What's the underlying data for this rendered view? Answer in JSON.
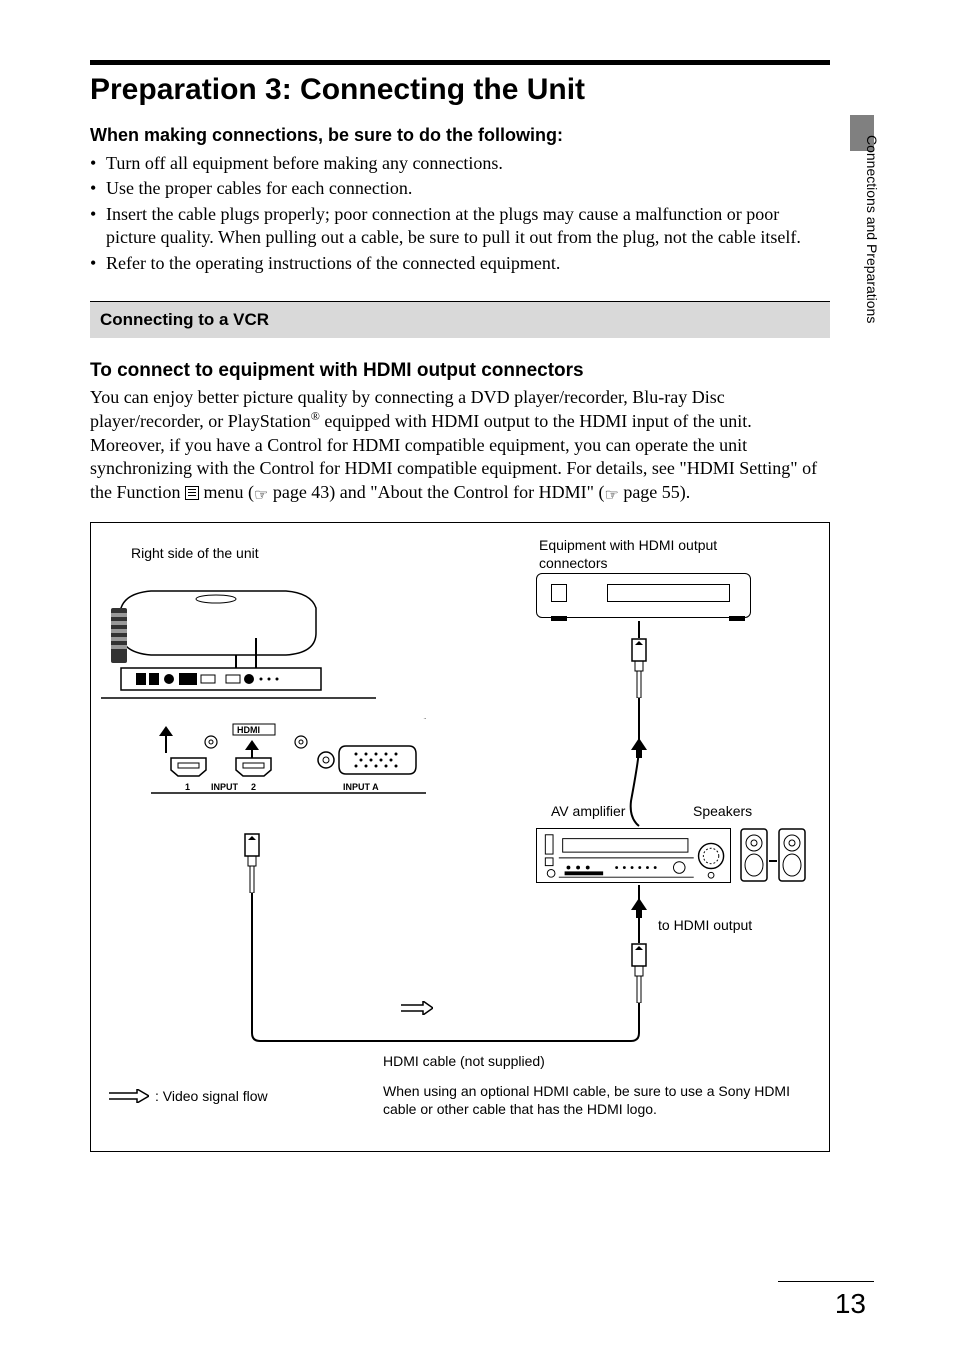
{
  "sideLabel": "Connections and Preparations",
  "title": "Preparation 3: Connecting the Unit",
  "sub1": "When making connections, be sure to do the following:",
  "bullets": [
    "Turn off all equipment before making any connections.",
    "Use the proper cables for each connection.",
    "Insert the cable plugs properly; poor connection at the plugs may cause a malfunction or poor picture quality. When pulling out a cable, be sure to pull it out from the plug, not the cable itself.",
    "Refer to the operating instructions of the connected equipment."
  ],
  "sectionBar": "Connecting to a VCR",
  "sub2": "To connect to equipment with HDMI output connectors",
  "body": {
    "p1a": "You can enjoy better picture quality by connecting a DVD player/recorder, Blu-ray Disc player/recorder, or PlayStation",
    "reg": "®",
    "p1b": " equipped with HDMI output to the HDMI input of the unit. Moreover, if you have a Control for HDMI compatible equipment, you can operate the unit synchronizing with the Control for HDMI compatible equipment. For details, see \"HDMI Setting\" of the Function ",
    "p1c": " menu (",
    "ptr": "☞",
    "pg43": " page 43) and \"About the Control for HDMI\" (",
    "pg55": " page 55)."
  },
  "diagram": {
    "unitLabel": "Right side of the unit",
    "equipLabel": "Equipment with HDMI output connectors",
    "avAmp": "AV amplifier",
    "speakers": "Speakers",
    "toHdmi": "to HDMI output",
    "cable": "HDMI cable (not supplied)",
    "signalFlow": ": Video signal flow",
    "note": "When using an optional HDMI cable, be sure to use a Sony HDMI cable or other cable that has the HDMI logo.",
    "hdmiLabel": "HDMI",
    "input1": "1",
    "inputLabel": "INPUT",
    "input2": "2",
    "inputA": "INPUT A"
  },
  "pageNumber": "13"
}
